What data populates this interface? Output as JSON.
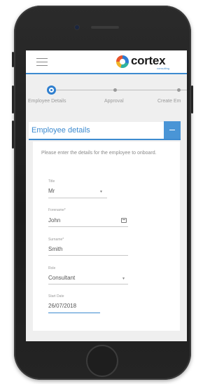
{
  "app": {
    "logo_text": "cortex",
    "logo_sub": "consulting"
  },
  "stepper": {
    "steps": [
      {
        "label": "Employee Details",
        "active": true
      },
      {
        "label": "Approval",
        "active": false
      },
      {
        "label": "Create Em",
        "active": false
      }
    ]
  },
  "section": {
    "title": "Employee details"
  },
  "form": {
    "intro": "Please enter the details for the employee to onboard.",
    "title": {
      "label": "Title",
      "value": "Mr"
    },
    "forename": {
      "label": "Forename*",
      "value": "John"
    },
    "surname": {
      "label": "Surname*",
      "value": "Smith"
    },
    "role": {
      "label": "Role",
      "value": "Consultant"
    },
    "start_date": {
      "label": "Start Date",
      "value": "26/07/2018"
    }
  },
  "colors": {
    "accent": "#3d8bd0",
    "phone_body": "#1c1c1c",
    "screen_bg": "#efefef"
  }
}
